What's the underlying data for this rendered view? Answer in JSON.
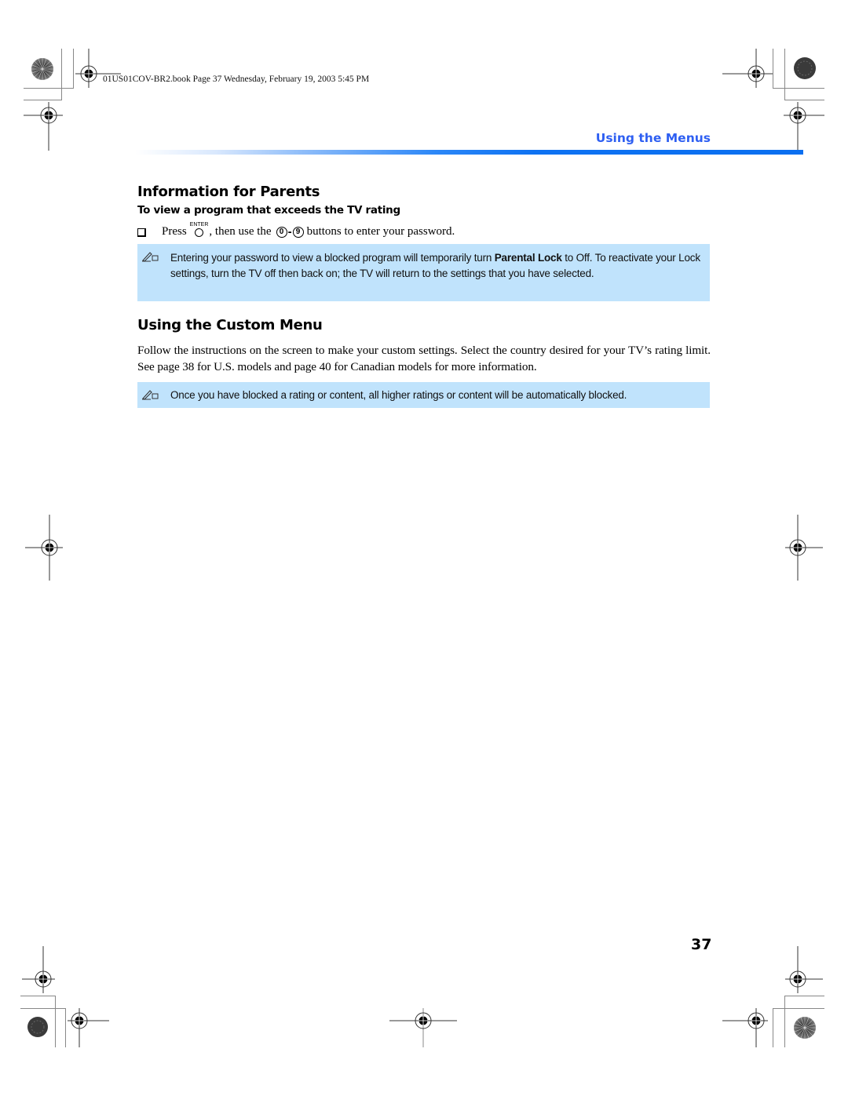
{
  "slug_line": "01US01COV-BR2.book  Page 37  Wednesday, February 19, 2003  5:45 PM",
  "section_header": "Using the Menus",
  "sections": [
    {
      "heading": "Information for Parents",
      "subheading": "To view a program that exceeds the TV rating",
      "step": {
        "prefix": "Press",
        "enter_key_label": "ENTER",
        "middle": ", then use the",
        "key_from": "0",
        "key_dash": "-",
        "key_to": "9",
        "suffix": "buttons to enter your password."
      },
      "note": {
        "icon": "pencil-note-icon",
        "text_before": "Entering your password to view a blocked program will temporarily turn ",
        "bold": "Parental Lock",
        "text_after": " to Off. To reactivate your Lock settings, turn the TV off then back on; the TV will return to the settings that you have selected."
      }
    },
    {
      "heading": "Using the Custom Menu",
      "body": "Follow the instructions on the screen to make your custom settings. Select the country desired for your TV’s rating limit. See page 38 for U.S. models and page 40 for Canadian models for more information.",
      "note": {
        "icon": "pencil-note-icon",
        "text": "Once you have blocked a rating or content, all higher ratings or content will be automatically blocked."
      }
    }
  ],
  "page_number": "37",
  "colors": {
    "section_header": "#2e5ff2",
    "rule": "#0a6ff0",
    "note_background": "#c0e3fc"
  }
}
